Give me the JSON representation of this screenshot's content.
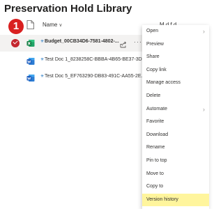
{
  "library": {
    "title": "Preservation Hold Library"
  },
  "step_badge": "1",
  "columns": {
    "name": "Name",
    "name_sort": "∨",
    "modified": "M  d f   d"
  },
  "files": [
    {
      "name": "Budget_00CB34D6-7581-4802-...",
      "type": "excel",
      "selected": true,
      "more": "···"
    },
    {
      "name": "Test Doc 1_8238258C-BBBA-4B65-BE37-3D...",
      "type": "word",
      "selected": false
    },
    {
      "name": "Test Doc 5_EF763290-DB83-491C-AA55-2E...",
      "type": "word",
      "selected": false
    }
  ],
  "context_menu": {
    "items": [
      {
        "label": "Open",
        "submenu": true
      },
      {
        "label": "Preview"
      },
      {
        "label": "Share"
      },
      {
        "label": "Copy link"
      },
      {
        "label": "Manage access"
      },
      {
        "label": "Delete"
      },
      {
        "label": "Automate",
        "submenu": true
      },
      {
        "label": "Favorite"
      },
      {
        "label": "Download"
      },
      {
        "label": "Rename"
      },
      {
        "label": "Pin to top"
      },
      {
        "label": "Move to"
      },
      {
        "label": "Copy to"
      },
      {
        "label": "Version history",
        "highlighted": true
      }
    ],
    "submenu_glyph": "›"
  },
  "colors": {
    "badge": "#d92020",
    "selected_check": "#c4262e",
    "highlight": "#fff59d",
    "excel": "#107c41",
    "word": "#185abd"
  },
  "icons": {
    "header": "document-icon",
    "excel": "excel-file-icon",
    "word": "word-file-icon",
    "share": "share-icon",
    "check": "check-circle-icon"
  }
}
